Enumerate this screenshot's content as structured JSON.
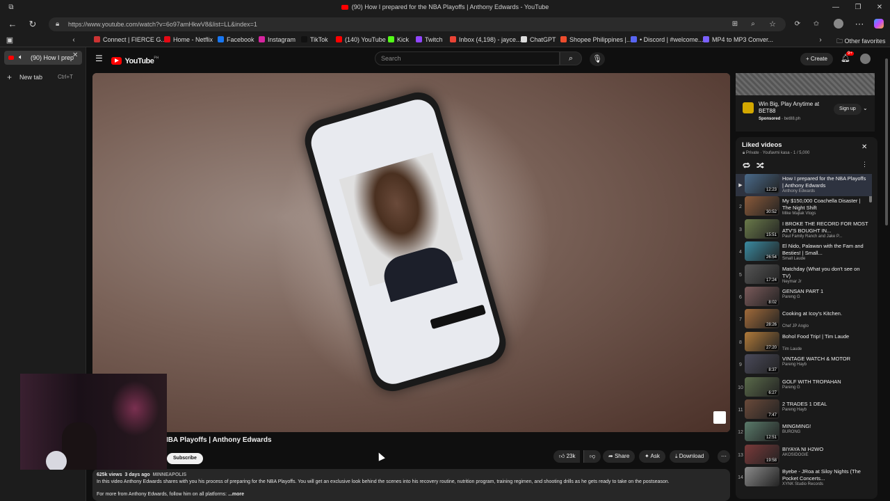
{
  "window": {
    "title": "(90) How I prepared for the NBA Playoffs | Anthony Edwards - YouTube"
  },
  "address": {
    "url": "https://www.youtube.com/watch?v=6o97amHkwV8&list=LL&index=1"
  },
  "bookmarks": [
    {
      "label": "Connect | FIERCE G...",
      "color": "#c33"
    },
    {
      "label": "Home - Netflix",
      "color": "#e50914"
    },
    {
      "label": "Facebook",
      "color": "#1877f2"
    },
    {
      "label": "Instagram",
      "color": "#d6249f"
    },
    {
      "label": "TikTok",
      "color": "#111"
    },
    {
      "label": "(140) YouTube",
      "color": "#f00"
    },
    {
      "label": "Kick",
      "color": "#53fc18"
    },
    {
      "label": "Twitch",
      "color": "#9146ff"
    },
    {
      "label": "Inbox (4,198) - jayce...",
      "color": "#ea4335"
    },
    {
      "label": "ChatGPT",
      "color": "#ddd"
    },
    {
      "label": "Shopee Philippines |...",
      "color": "#ee4d2d"
    },
    {
      "label": "• Discord | #welcome...",
      "color": "#5865f2"
    },
    {
      "label": "MP4 to MP3 Conver...",
      "color": "#7b61ff"
    }
  ],
  "other_favorites": "Other favorites",
  "sidebar": {
    "tab_title": "(90) How I prep",
    "new_tab": "New tab",
    "new_tab_shortcut": "Ctrl+T"
  },
  "youtube": {
    "logo": "YouTube",
    "logo_region": "PH",
    "search_placeholder": "Search",
    "create": "Create",
    "notif_count": "9+"
  },
  "ad": {
    "title": "Win Big, Play Anytime at BET88",
    "sponsored": "Sponsored",
    "domain": "bet88.ph",
    "cta": "Sign up"
  },
  "playlist": {
    "title": "Liked videos",
    "meta_private": "Private",
    "meta_channel": "Youfavmi kasa",
    "meta_count": "1 / 5,000",
    "items": [
      {
        "n": "",
        "title": "How I prepared for the NBA Playoffs | Anthony Edwards",
        "channel": "Anthony Edwards",
        "dur": "12:23",
        "color": "#4a6a8a"
      },
      {
        "n": "2",
        "title": "My $150,000 Coachella Disaster | The Night Shift",
        "channel": "Mike Majlak Vlogs",
        "dur": "30:52",
        "color": "#8a5a3a"
      },
      {
        "n": "3",
        "title": "I BROKE THE RECORD FOR MOST ATV'S BOUGHT IN...",
        "channel": "Paul Family Ranch and Jake P...",
        "dur": "15:51",
        "color": "#6a7a4a"
      },
      {
        "n": "4",
        "title": "El Nido, Palawan with the Fam and Besties! | Small...",
        "channel": "Small Laude",
        "dur": "26:54",
        "color": "#3a8aa0"
      },
      {
        "n": "5",
        "title": "Matchday (What you don't see on TV)",
        "channel": "Neymar Jr",
        "dur": "17:24",
        "color": "#555"
      },
      {
        "n": "6",
        "title": "GENSAN PART 1",
        "channel": "Pareng G",
        "dur": "8:02",
        "color": "#7a5a5a"
      },
      {
        "n": "7",
        "title": "Cooking at Icoy's Kitchen.",
        "channel": "Chef JP Anglo",
        "dur": "28:26",
        "color": "#a06a3a"
      },
      {
        "n": "8",
        "title": "Bohol Food Trip! | Tim Laude",
        "channel": "Tim Laude",
        "dur": "27:20",
        "color": "#b07a3a"
      },
      {
        "n": "9",
        "title": "VINTAGE WATCH & MOTOR",
        "channel": "Pareng Hayb",
        "dur": "8:37",
        "color": "#4a4a5a"
      },
      {
        "n": "10",
        "title": "GOLF WITH TROPAHAN",
        "channel": "Pareng G",
        "dur": "6:27",
        "color": "#5a6a4a"
      },
      {
        "n": "11",
        "title": "2 TRADES 1 DEAL",
        "channel": "Pareng Hayb",
        "dur": "7:47",
        "color": "#6a4a3a"
      },
      {
        "n": "12",
        "title": "MINGMING!",
        "channel": "BURONG",
        "dur": "12:51",
        "color": "#5a7a6a"
      },
      {
        "n": "13",
        "title": "BIYAYA NI H2WO",
        "channel": "AKOSIDOGIE",
        "dur": "19:58",
        "color": "#7a3a3a"
      },
      {
        "n": "14",
        "title": "Byebe - JRoa at Siloy Nights (The Pocket Concerts...",
        "channel": "XYNK Studio Records",
        "dur": "",
        "color": "#8a8a8a"
      }
    ]
  },
  "video": {
    "title": "IBA Playoffs | Anthony Edwards",
    "subscribe": "Subscribe",
    "likes": "23k",
    "share": "Share",
    "ask": "Ask",
    "download": "Download",
    "views": "625k views",
    "date": "3 days ago",
    "location": "MINNEAPOLIS",
    "description": "In this video Anthony Edwards shares with you his process of preparing for the NBA Playoffs. You will get an exclusive look behind the scenes into his recovery routine, nutrition program, training regimen, and shooting drills as he gets ready to take on the postseason.",
    "description2": "For more from Anthony Edwards, follow him on all platforms:",
    "more": "...more"
  }
}
